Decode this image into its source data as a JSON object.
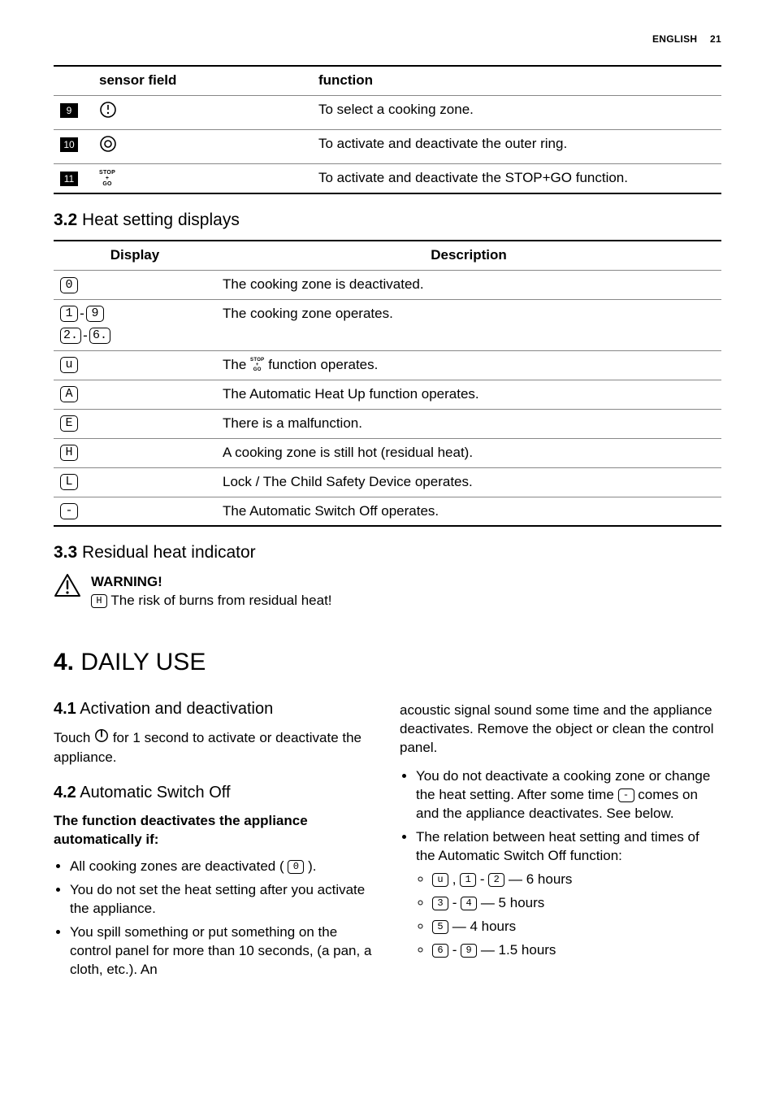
{
  "running_head": {
    "lang": "ENGLISH",
    "page": "21"
  },
  "sensor_table": {
    "headers": {
      "c1": "sensor field",
      "c2": "function"
    },
    "rows": [
      {
        "num": "9",
        "icon": "zone-select-icon",
        "func": "To select a cooking zone."
      },
      {
        "num": "10",
        "icon": "outer-ring-icon",
        "func": "To activate and deactivate the outer ring."
      },
      {
        "num": "11",
        "icon": "stop-go-icon",
        "stop": "STOP",
        "plus": "+",
        "go": "GO",
        "func": "To activate and deactivate the STOP+GO function."
      }
    ]
  },
  "sec32": {
    "num": "3.2",
    "title": "Heat setting displays"
  },
  "display_table": {
    "headers": {
      "c1": "Display",
      "c2": "Description"
    },
    "rows": [
      {
        "d": [
          "0"
        ],
        "desc": "The cooking zone is deactivated."
      },
      {
        "d_pairA": [
          "1",
          "9"
        ],
        "d_pairB": [
          "2.",
          "6."
        ],
        "desc": "The cooking zone operates."
      },
      {
        "d": [
          "u"
        ],
        "desc_pre": "The ",
        "desc_post": " function operates.",
        "inline_icon": "stop-go-icon",
        "stop": "STOP",
        "plus": "+",
        "go": "GO"
      },
      {
        "d": [
          "A"
        ],
        "desc": "The Automatic Heat Up function operates."
      },
      {
        "d": [
          "E"
        ],
        "desc": "There is a malfunction."
      },
      {
        "d": [
          "H"
        ],
        "desc": "A cooking zone is still hot (residual heat)."
      },
      {
        "d": [
          "L"
        ],
        "desc": "Lock / The Child Safety Device operates."
      },
      {
        "d": [
          "-"
        ],
        "desc": "The Automatic Switch Off operates."
      }
    ]
  },
  "sec33": {
    "num": "3.3",
    "title": "Residual heat indicator"
  },
  "warning": {
    "label": "WARNING!",
    "seg": "H",
    "text_pre": " The risk of burns from residual heat!"
  },
  "chapter4": {
    "num": "4.",
    "title": "DAILY USE"
  },
  "sec41": {
    "num": "4.1",
    "title": "Activation and deactivation",
    "body_pre": "Touch ",
    "body_post": " for 1 second to activate or deactivate the appliance."
  },
  "sec42": {
    "num": "4.2",
    "title": "Automatic Switch Off",
    "lead": "The function deactivates the appliance automatically if:",
    "b1_pre": "All cooking zones are deactivated ( ",
    "b1_seg": "0",
    "b1_post": " ).",
    "b2": "You do not set the heat setting after you activate the appliance.",
    "b3": "You spill something or put something on the control panel for more than 10 seconds, (a pan, a cloth, etc.). An",
    "col2_top": "acoustic signal sound some time and the appliance deactivates. Remove the object or clean the control panel.",
    "b4_pre": "You do not deactivate a cooking zone or change the heat setting. After some time ",
    "b4_seg": "-",
    "b4_post": " comes on and the appliance deactivates. See below.",
    "b5": "The relation between heat setting and times of the Automatic Switch Off function:",
    "times": {
      "r1": {
        "a": "u",
        "b": "1",
        "c": "2",
        "t": " — 6 hours"
      },
      "r2": {
        "a": "3",
        "b": "4",
        "t": " — 5 hours"
      },
      "r3": {
        "a": "5",
        "t": " — 4 hours"
      },
      "r4": {
        "a": "6",
        "b": "9",
        "t": " — 1.5 hours"
      }
    }
  },
  "sep": {
    "dash": " - ",
    "comma": " , "
  }
}
